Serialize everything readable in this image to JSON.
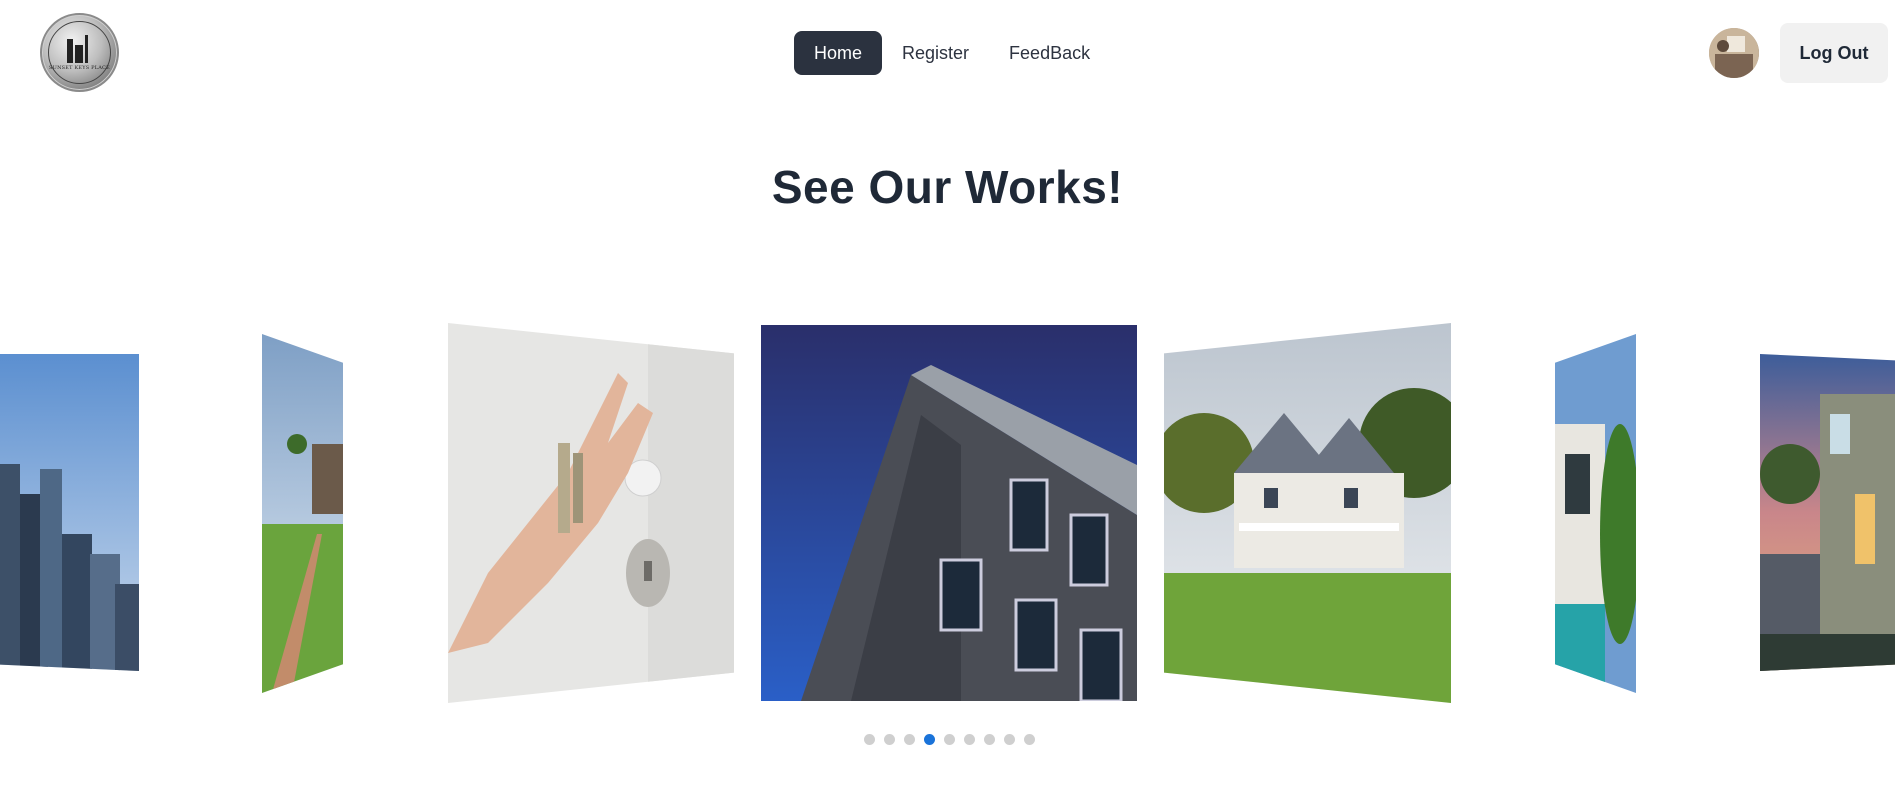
{
  "nav": {
    "items": [
      {
        "label": "Home",
        "active": true
      },
      {
        "label": "Register",
        "active": false
      },
      {
        "label": "FeedBack",
        "active": false
      }
    ]
  },
  "header": {
    "logo_text": "SUNSET KEYS PLACE",
    "logout_label": "Log Out"
  },
  "main": {
    "title": "See Our Works!"
  },
  "carousel": {
    "slides": [
      {
        "subject": "city-towers"
      },
      {
        "subject": "suburban-street"
      },
      {
        "subject": "hand-with-keys"
      },
      {
        "subject": "modern-brick-building"
      },
      {
        "subject": "white-farmhouse"
      },
      {
        "subject": "modern-house-with-pool"
      },
      {
        "subject": "townhouses-at-dusk"
      }
    ],
    "dot_count": 9,
    "active_dot": 4
  },
  "colors": {
    "nav_active_bg": "#2b323f",
    "dot_active": "#1a73d9",
    "dot_inactive": "#cfcfcf",
    "logout_bg": "#f1f1f1"
  }
}
